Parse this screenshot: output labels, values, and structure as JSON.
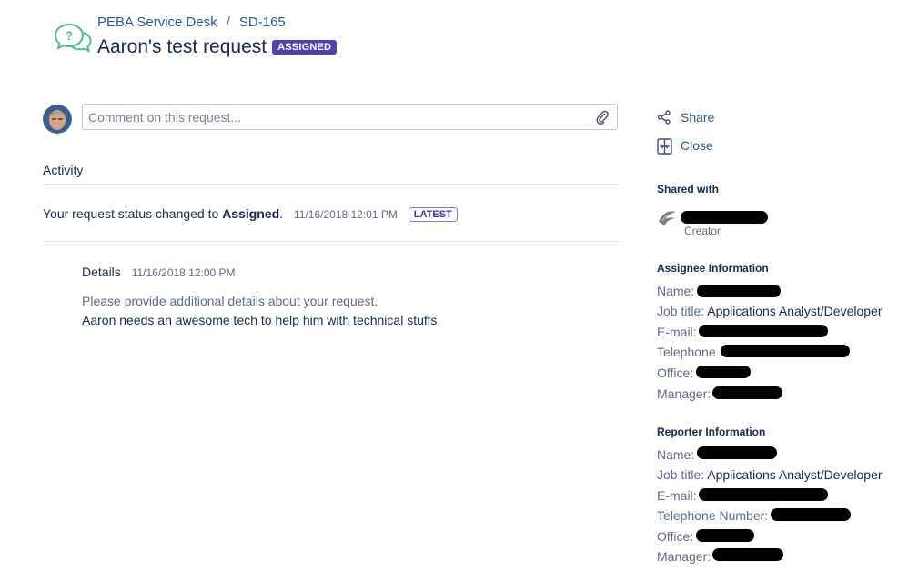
{
  "header": {
    "project": "PEBA Service Desk",
    "separator": "/",
    "issue_key": "SD-165",
    "title": "Aaron's test request",
    "status_badge": "ASSIGNED"
  },
  "comment": {
    "placeholder": "Comment on this request..."
  },
  "activity": {
    "heading": "Activity",
    "status_prefix": "Your request status changed to",
    "status_value": "Assigned",
    "status_suffix": ".",
    "status_timestamp": "11/16/2018 12:01 PM",
    "latest_badge": "LATEST",
    "details_label": "Details",
    "details_timestamp": "11/16/2018 12:00 PM",
    "details_line1": "Please provide additional details about your request.",
    "details_line2": "Aaron needs an awesome tech to help him with technical stuffs."
  },
  "sidebar": {
    "share_label": "Share",
    "close_label": "Close",
    "shared_with_heading": "Shared with",
    "creator_label": "Creator",
    "assignee": {
      "heading": "Assignee Information",
      "name_label": "Name:",
      "job_label": "Job title:",
      "job_value": "Applications Analyst/Developer",
      "email_label": "E-mail:",
      "telephone_label": "Telephone",
      "office_label": "Office:",
      "manager_label": "Manager:"
    },
    "reporter": {
      "heading": "Reporter Information",
      "name_label": "Name:",
      "job_label": "Job title:",
      "job_value": "Applications Analyst/Developer",
      "email_label": "E-mail:",
      "telephone_label": "Telephone Number:",
      "office_label": "Office:",
      "manager_label": "Manager:"
    }
  },
  "colors": {
    "link": "#2e5a8c",
    "badge_purple": "#5243aa",
    "text": "#172b4d",
    "muted": "#5e6c84",
    "logo_green": "#57b9a0"
  },
  "icons": [
    "help-chat-icon",
    "paperclip-icon",
    "share-icon",
    "close-request-icon",
    "creator-avatar-icon"
  ]
}
